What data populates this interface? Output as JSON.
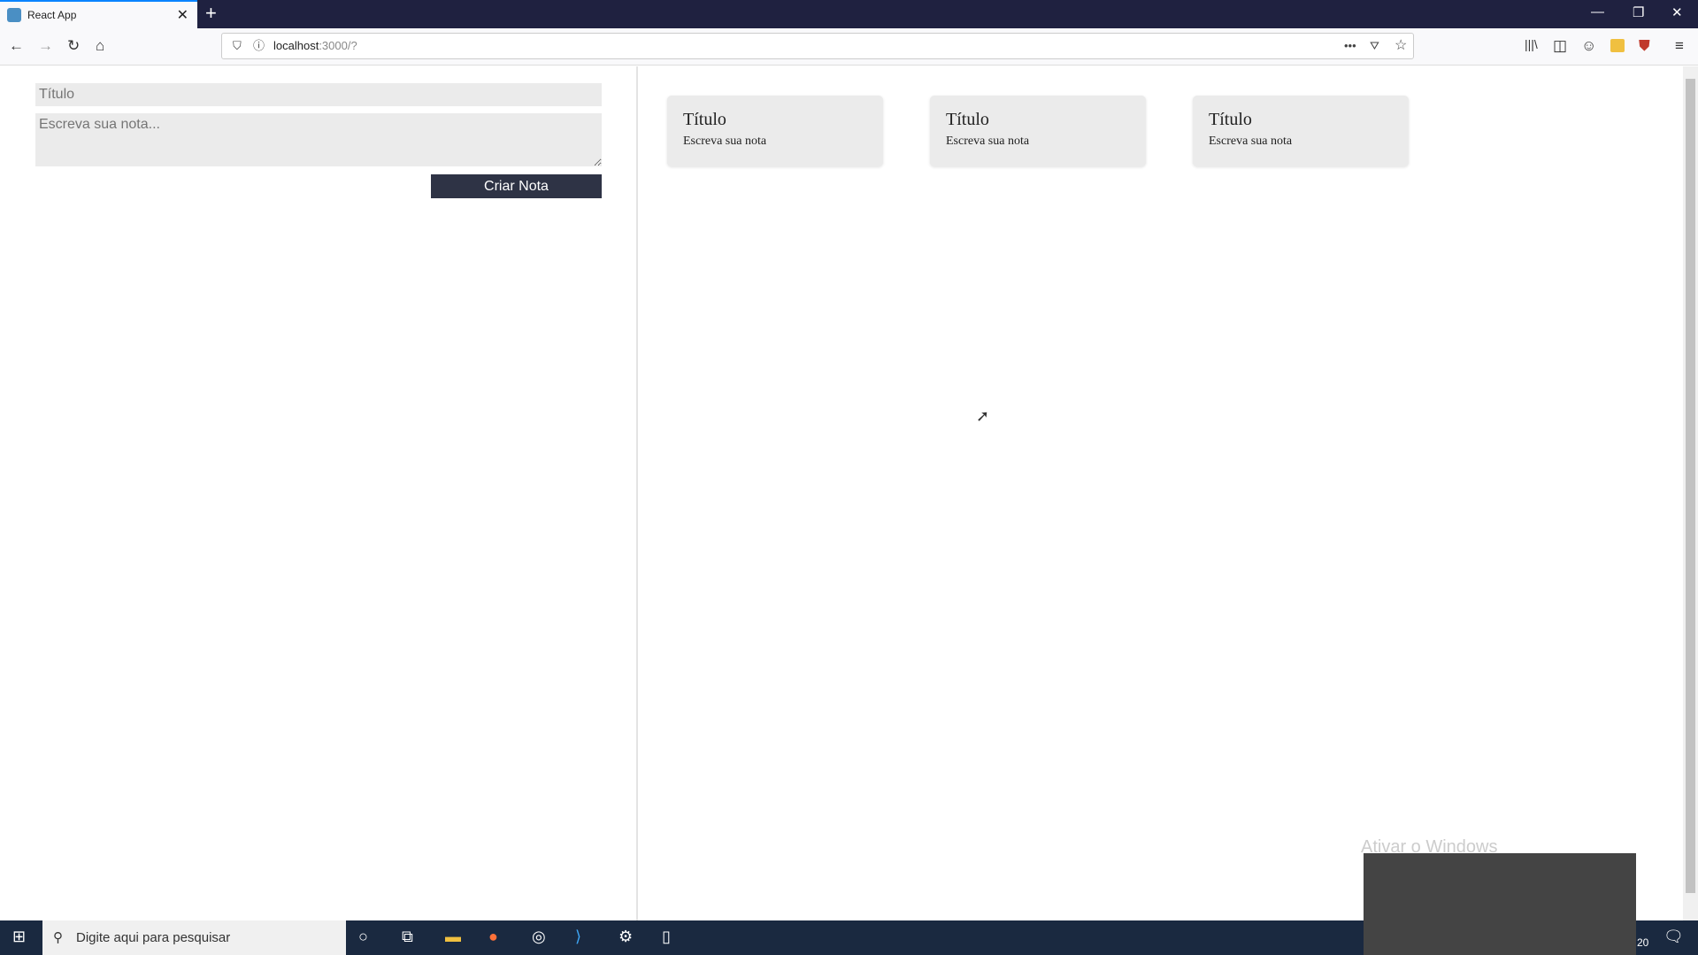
{
  "browser": {
    "tab_title": "React App",
    "url_host": "localhost",
    "url_rest": ":3000/?"
  },
  "form": {
    "title_placeholder": "Título",
    "note_placeholder": "Escreva sua nota...",
    "submit_label": "Criar Nota"
  },
  "notes": [
    {
      "title": "Título",
      "body": "Escreva sua nota"
    },
    {
      "title": "Título",
      "body": "Escreva sua nota"
    },
    {
      "title": "Título",
      "body": "Escreva sua nota"
    }
  ],
  "taskbar": {
    "search_placeholder": "Digite aqui para pesquisar",
    "clock_fragment": "20"
  },
  "watermark": "Ativar o Windows",
  "colors": {
    "button": "#2e3345",
    "card": "#ebebeb",
    "tabbar": "#1f2140",
    "taskbar": "#1a2940"
  }
}
